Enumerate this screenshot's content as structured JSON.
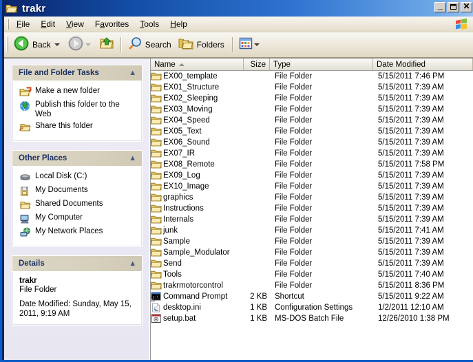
{
  "window": {
    "title": "trakr",
    "title_icon": "folder-open-icon",
    "buttons": {
      "minimize": "_",
      "maximize": "❐",
      "close": "✕"
    }
  },
  "menubar": {
    "items": [
      {
        "name": "file",
        "label": "File",
        "accel": "F"
      },
      {
        "name": "edit",
        "label": "Edit",
        "accel": "E"
      },
      {
        "name": "view",
        "label": "View",
        "accel": "V"
      },
      {
        "name": "favorites",
        "label": "Favorites",
        "accel": "a"
      },
      {
        "name": "tools",
        "label": "Tools",
        "accel": "T"
      },
      {
        "name": "help",
        "label": "Help",
        "accel": "H"
      }
    ],
    "logo": "windows-flag-logo"
  },
  "toolbar": {
    "back_label": "Back",
    "back_icon": "back-arrow-icon",
    "back_dropdown_icon": "chevron-down-icon",
    "forward_icon": "forward-arrow-icon",
    "forward_dropdown_icon": "chevron-down-icon",
    "up_icon": "up-folder-icon",
    "search_label": "Search",
    "search_icon": "magnifier-icon",
    "folders_label": "Folders",
    "folders_icon": "folders-icon",
    "views_icon": "views-icon",
    "views_dropdown_icon": "chevron-down-icon"
  },
  "sidebar": {
    "panels": [
      {
        "name": "file-and-folder-tasks",
        "title": "File and Folder Tasks",
        "collapse_icon": "chevron-up-icon",
        "items": [
          {
            "name": "make-a-new-folder",
            "label": "Make a new folder",
            "icon": "new-folder-icon"
          },
          {
            "name": "publish-this-folder-to-the-web",
            "label": "Publish this folder to the Web",
            "icon": "publish-web-icon"
          },
          {
            "name": "share-this-folder",
            "label": "Share this folder",
            "icon": "share-folder-icon"
          }
        ]
      },
      {
        "name": "other-places",
        "title": "Other Places",
        "collapse_icon": "chevron-up-icon",
        "items": [
          {
            "name": "local-disk-c",
            "label": "Local Disk (C:)",
            "icon": "hard-disk-icon"
          },
          {
            "name": "my-documents",
            "label": "My Documents",
            "icon": "my-documents-icon"
          },
          {
            "name": "shared-documents",
            "label": "Shared Documents",
            "icon": "shared-documents-icon"
          },
          {
            "name": "my-computer",
            "label": "My Computer",
            "icon": "my-computer-icon"
          },
          {
            "name": "my-network-places",
            "label": "My Network Places",
            "icon": "network-places-icon"
          }
        ]
      },
      {
        "name": "details",
        "title": "Details",
        "collapse_icon": "chevron-up-icon",
        "item_name": "trakr",
        "item_type": "File Folder",
        "date_modified": "Date Modified: Sunday, May 15, 2011, 9:19 AM"
      }
    ]
  },
  "filelist": {
    "columns": [
      {
        "name": "name",
        "label": "Name",
        "sorted": "asc",
        "sort_icon": "sort-ascending-icon"
      },
      {
        "name": "size",
        "label": "Size"
      },
      {
        "name": "type",
        "label": "Type"
      },
      {
        "name": "date-modified",
        "label": "Date Modified"
      }
    ],
    "rows": [
      {
        "icon": "folder-icon",
        "name": "EX00_template",
        "size": "",
        "type": "File Folder",
        "date": "5/15/2011 7:46 PM"
      },
      {
        "icon": "folder-icon",
        "name": "EX01_Structure",
        "size": "",
        "type": "File Folder",
        "date": "5/15/2011 7:39 AM"
      },
      {
        "icon": "folder-icon",
        "name": "EX02_Sleeping",
        "size": "",
        "type": "File Folder",
        "date": "5/15/2011 7:39 AM"
      },
      {
        "icon": "folder-icon",
        "name": "EX03_Moving",
        "size": "",
        "type": "File Folder",
        "date": "5/15/2011 7:39 AM"
      },
      {
        "icon": "folder-icon",
        "name": "EX04_Speed",
        "size": "",
        "type": "File Folder",
        "date": "5/15/2011 7:39 AM"
      },
      {
        "icon": "folder-icon",
        "name": "EX05_Text",
        "size": "",
        "type": "File Folder",
        "date": "5/15/2011 7:39 AM"
      },
      {
        "icon": "folder-icon",
        "name": "EX06_Sound",
        "size": "",
        "type": "File Folder",
        "date": "5/15/2011 7:39 AM"
      },
      {
        "icon": "folder-icon",
        "name": "EX07_IR",
        "size": "",
        "type": "File Folder",
        "date": "5/15/2011 7:39 AM"
      },
      {
        "icon": "folder-icon",
        "name": "EX08_Remote",
        "size": "",
        "type": "File Folder",
        "date": "5/15/2011 7:58 PM"
      },
      {
        "icon": "folder-icon",
        "name": "EX09_Log",
        "size": "",
        "type": "File Folder",
        "date": "5/15/2011 7:39 AM"
      },
      {
        "icon": "folder-icon",
        "name": "EX10_Image",
        "size": "",
        "type": "File Folder",
        "date": "5/15/2011 7:39 AM"
      },
      {
        "icon": "folder-icon",
        "name": "graphics",
        "size": "",
        "type": "File Folder",
        "date": "5/15/2011 7:39 AM"
      },
      {
        "icon": "folder-icon",
        "name": "Instructions",
        "size": "",
        "type": "File Folder",
        "date": "5/15/2011 7:39 AM"
      },
      {
        "icon": "folder-icon",
        "name": "Internals",
        "size": "",
        "type": "File Folder",
        "date": "5/15/2011 7:39 AM"
      },
      {
        "icon": "folder-icon",
        "name": "junk",
        "size": "",
        "type": "File Folder",
        "date": "5/15/2011 7:41 AM"
      },
      {
        "icon": "folder-icon",
        "name": "Sample",
        "size": "",
        "type": "File Folder",
        "date": "5/15/2011 7:39 AM"
      },
      {
        "icon": "folder-icon",
        "name": "Sample_Modulator",
        "size": "",
        "type": "File Folder",
        "date": "5/15/2011 7:39 AM"
      },
      {
        "icon": "folder-icon",
        "name": "Send",
        "size": "",
        "type": "File Folder",
        "date": "5/15/2011 7:39 AM"
      },
      {
        "icon": "folder-icon",
        "name": "Tools",
        "size": "",
        "type": "File Folder",
        "date": "5/15/2011 7:40 AM"
      },
      {
        "icon": "folder-icon",
        "name": "trakrmotorcontrol",
        "size": "",
        "type": "File Folder",
        "date": "5/15/2011 8:36 PM"
      },
      {
        "icon": "command-prompt-shortcut-icon",
        "name": "Command Prompt",
        "size": "2 KB",
        "type": "Shortcut",
        "date": "5/15/2011 9:22 AM"
      },
      {
        "icon": "ini-file-icon",
        "name": "desktop.ini",
        "size": "1 KB",
        "type": "Configuration Settings",
        "date": "1/2/2011 12:10 AM"
      },
      {
        "icon": "batch-file-icon",
        "name": "setup.bat",
        "size": "1 KB",
        "type": "MS-DOS Batch File",
        "date": "12/26/2010 1:38 PM"
      }
    ]
  },
  "colors": {
    "title_bar_start": "#0A246A",
    "title_bar_end": "#9CC4F0",
    "panel_header": "#DCD7C6",
    "panel_title_text": "#1D3264",
    "sidebar_bg": "#ECEAF4",
    "folder_yellow": "#F3D978"
  }
}
